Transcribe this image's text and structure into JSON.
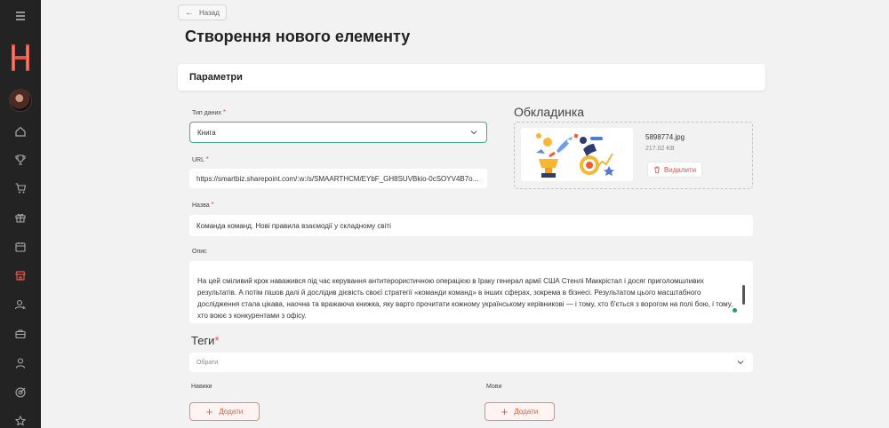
{
  "sidebar": {
    "icons": [
      "menu-icon",
      "home-icon",
      "trophy-icon",
      "cart-icon",
      "gift-icon",
      "calendar-icon",
      "store-icon",
      "users-search-icon",
      "briefcase-icon",
      "user-icon",
      "target-icon",
      "star-icon"
    ],
    "active_color": "#e5534b"
  },
  "back_label": "Назад",
  "page_title": "Створення нового елементу",
  "section_title": "Параметри",
  "form": {
    "type_label": "Тип даних",
    "type_value": "Книга",
    "url_label": "URL",
    "url_value": "https://smartbiz.sharepoint.com/:w:/s/SMAARTHCM/EYbF_GH8SUVBkio-0cSOYV4B7o...",
    "name_label": "Назва",
    "name_value": "Команда команд. Нові правила взаємодії у складному світі",
    "desc_label": "Опис",
    "desc_value": "На цей сміливий крок наважився під час керування антитерористичною операцією в Іраку генерал армії США Стенлі Маккрістал і досяг приголомшливих результатів. А потім пішов далі й дослідив дієвість своєї стратегії «команди команд» в інших сферах, зокрема в бізнесі. Результатом цього масштабного дослідження стала цікава, наочна та вражаюча книжка, яку варто прочитати кожному українському керівникові — і тому, хто б'ється з ворогом на полі бою, і тому, хто воює з конкурентами з офісу.",
    "required_mark": "*"
  },
  "cover": {
    "title": "Обкладинка",
    "file_name": "5898774.jpg",
    "file_size": "217.02 KB",
    "delete_label": "Видалити"
  },
  "tags": {
    "title": "Теги",
    "placeholder": "Обрати"
  },
  "skills": {
    "label": "Навики",
    "add_label": "Додати"
  },
  "languages": {
    "label": "Мови",
    "add_label": "Додати"
  },
  "colors": {
    "accent": "#e5593b",
    "focus": "#3fb08a",
    "sidebar": "#232323"
  }
}
